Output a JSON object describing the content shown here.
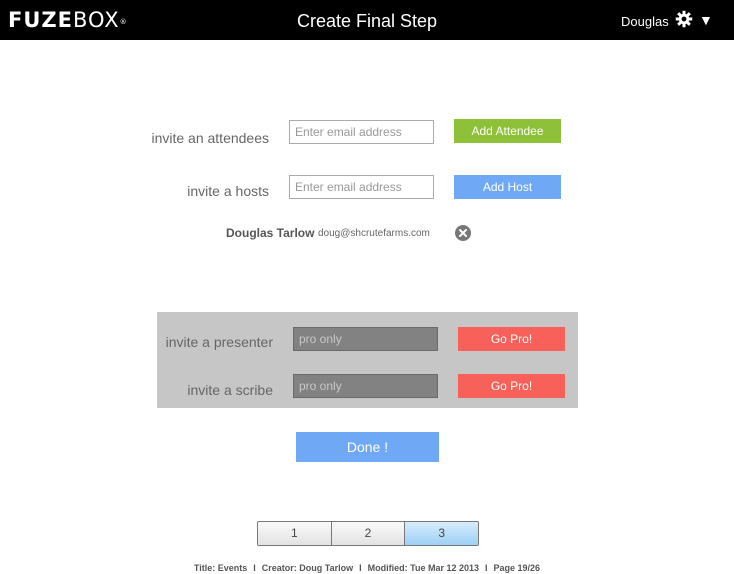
{
  "header": {
    "logo_text": "FUZE",
    "logo_text_2": "BOX",
    "logo_mark": "®",
    "title": "Create Final Step",
    "user_name": "Douglas",
    "settings_icon": "gear-icon",
    "menu_icon": "caret-down-icon",
    "caret": "▼"
  },
  "invite": {
    "attendees": {
      "label": "invite an attendees",
      "placeholder": "Enter email address",
      "button": "Add Attendee"
    },
    "hosts": {
      "label": "invite a hosts",
      "placeholder": "Enter email address",
      "button": "Add Host"
    },
    "host_entry": {
      "name": "Douglas Tarlow",
      "email": "doug@shcrutefarms.com",
      "remove_icon": "remove-circle-icon"
    }
  },
  "pro_panel": {
    "presenter": {
      "label": "invite a presenter",
      "placeholder": "pro only",
      "button": "Go Pro!"
    },
    "scribe": {
      "label": "invite a scribe",
      "placeholder": "pro only",
      "button": "Go Pro!"
    }
  },
  "done_label": "Done !",
  "pagination": {
    "pages": [
      "1",
      "2",
      "3"
    ],
    "current": "3"
  },
  "footer": {
    "title": "Title: Events",
    "creator": "Creator: Doug Tarlow",
    "modified": "Modified: Tue Mar 12 2013",
    "page": "Page 19/26",
    "separator": "I"
  },
  "colors": {
    "topbar": "#000000",
    "add_attendee": "#8ec038",
    "add_host": "#6fa8f5",
    "go_pro": "#f7615a",
    "done": "#6fa8f5",
    "panel": "#c6c6c6",
    "active_page": "#9dd0f5"
  }
}
